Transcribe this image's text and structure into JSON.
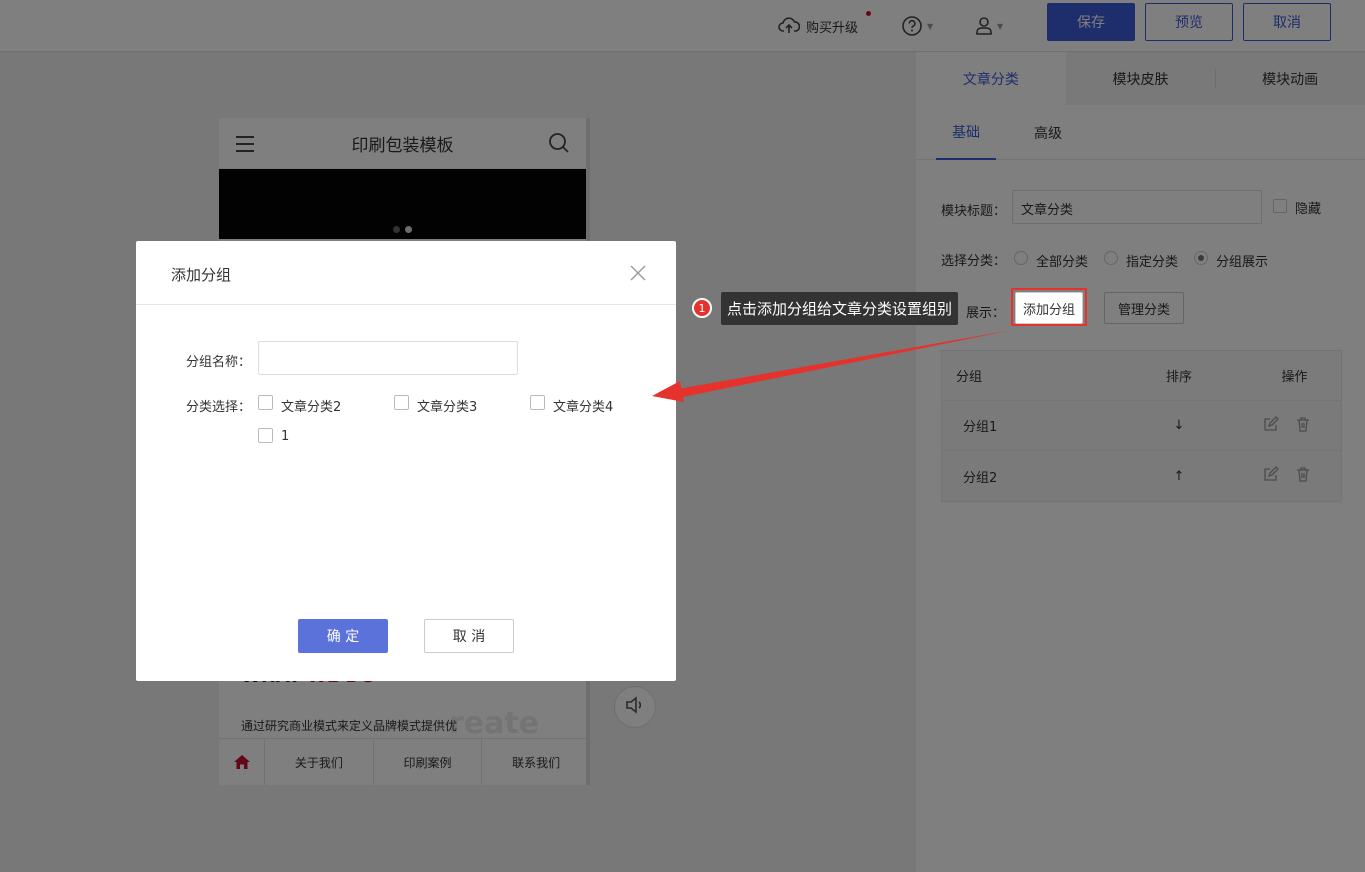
{
  "topbar": {
    "upgrade_label": "购买升级",
    "save_label": "保存",
    "preview_label": "预览",
    "cancel_label": "取消"
  },
  "phone": {
    "title": "印刷包装模板",
    "section_title_a": "WHAT ",
    "section_title_b": "WE DO",
    "desc": "通过研究商业模式来定义品牌模式提供优",
    "watermark": "reate",
    "nav": [
      "关于我们",
      "印刷案例",
      "联系我们"
    ]
  },
  "panel": {
    "tabs": [
      "文章分类",
      "模块皮肤",
      "模块动画"
    ],
    "sub_tabs": [
      "基础",
      "高级"
    ],
    "title_label": "模块标题：",
    "title_value": "文章分类",
    "hide_label": "隐藏",
    "select_label": "选择分类：",
    "options": [
      "全部分类",
      "指定分类",
      "分组展示"
    ],
    "display_label": "展示：",
    "add_group_btn": "添加分组",
    "manage_btn": "管理分类",
    "table": {
      "headers": [
        "分组",
        "排序",
        "操作"
      ],
      "rows": [
        {
          "name": "分组1",
          "sort": "↓"
        },
        {
          "name": "分组2",
          "sort": "↑"
        }
      ]
    }
  },
  "dialog": {
    "title": "添加分组",
    "name_label": "分组名称：",
    "name_value": "",
    "category_label": "分类选择：",
    "categories": [
      "文章分类2",
      "文章分类3",
      "文章分类4",
      "1"
    ],
    "ok_label": "确 定",
    "cancel_label": "取 消"
  },
  "annotation": {
    "badge": "1",
    "text": "点击添加分组给文章分类设置组别",
    "highlight_color": "#e5322d"
  },
  "colors": {
    "accent": "#3d5ad8",
    "dialog_ok": "#5a72d9",
    "brand_red": "#c8102e"
  }
}
